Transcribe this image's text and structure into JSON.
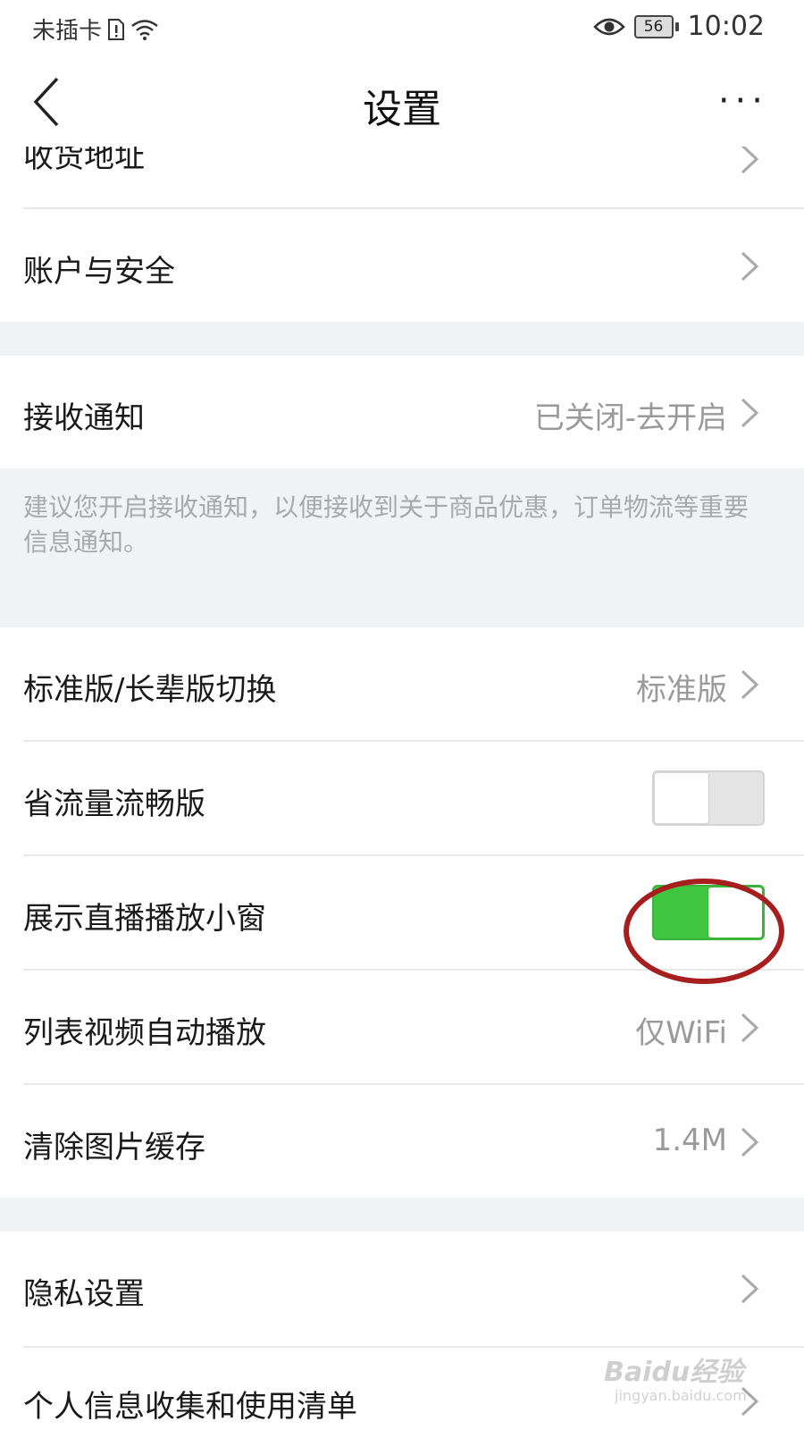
{
  "status_bar": {
    "carrier": "未插卡",
    "battery": "56",
    "time": "10:02"
  },
  "nav": {
    "title": "设置",
    "more": "···"
  },
  "rows": {
    "address": {
      "label": "收货地址"
    },
    "account": {
      "label": "账户与安全"
    },
    "notify": {
      "label": "接收通知",
      "value": "已关闭-去开启"
    },
    "notify_hint": "建议您开启接收通知，以便接收到关于商品优惠，订单物流等重要信息通知。",
    "mode": {
      "label": "标准版/长辈版切换",
      "value": "标准版"
    },
    "data_saver": {
      "label": "省流量流畅版",
      "enabled": false
    },
    "live_window": {
      "label": "展示直播播放小窗",
      "enabled": true
    },
    "autoplay": {
      "label": "列表视频自动播放",
      "value": "仅WiFi"
    },
    "cache": {
      "label": "清除图片缓存",
      "value": "1.4M"
    },
    "privacy": {
      "label": "隐私设置"
    },
    "personal_info": {
      "label": "个人信息收集和使用清单"
    }
  },
  "colors": {
    "toggle_on": "#3fc53f",
    "toggle_off": "#e4e4e4",
    "annotation": "#a61e1e",
    "section_gap": "#f1f2f4"
  },
  "watermark": {
    "brand": "Baidu经验",
    "url": "jingyan.baidu.com"
  }
}
